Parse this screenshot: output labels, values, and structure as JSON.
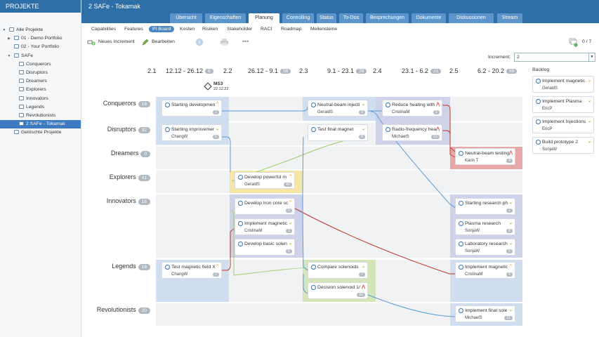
{
  "sidebar": {
    "title": "PROJEKTE",
    "items": [
      {
        "label": "Alle Projekte",
        "indent": 0,
        "arrow": "▼"
      },
      {
        "label": "01 - Demo Portfolio",
        "indent": 1,
        "arrow": "▶"
      },
      {
        "label": "02 - Your Portfolio",
        "indent": 1,
        "arrow": ""
      },
      {
        "label": "SAFe",
        "indent": 1,
        "arrow": "▼"
      },
      {
        "label": "Conquerors",
        "indent": 2,
        "arrow": ""
      },
      {
        "label": "Disruptors",
        "indent": 2,
        "arrow": ""
      },
      {
        "label": "Dreamers",
        "indent": 2,
        "arrow": ""
      },
      {
        "label": "Explorers",
        "indent": 2,
        "arrow": ""
      },
      {
        "label": "Innovators",
        "indent": 2,
        "arrow": ""
      },
      {
        "label": "Legends",
        "indent": 2,
        "arrow": ""
      },
      {
        "label": "Revolutionists",
        "indent": 2,
        "arrow": ""
      },
      {
        "label": "2 SAFe - Tokamak",
        "indent": 2,
        "arrow": "",
        "selected": true
      },
      {
        "label": "Gelöschte Projekte",
        "indent": 1,
        "arrow": ""
      }
    ]
  },
  "header": {
    "title": "2 SAFe - Tokamak"
  },
  "tabs": [
    "Übersicht",
    "Eigenschaften",
    "Planung",
    "Controlling",
    "Status",
    "To-Dos",
    "Besprechungen",
    "Dokumente",
    "Diskussionen",
    "Stream"
  ],
  "active_tab": "Planung",
  "subnav": [
    "Capabilities",
    "Features",
    "PI Board",
    "Kosten",
    "Risiken",
    "Stakeholder",
    "RACI",
    "Roadmap",
    "Meilensteine"
  ],
  "active_subnav": "PI Board",
  "toolbar": {
    "new_increment": "Neues Increment",
    "edit": "Bearbeiten",
    "counter": "0 / 7"
  },
  "increment": {
    "label": "Increment:",
    "value": "2"
  },
  "iterations": [
    {
      "label": "2.1"
    },
    {
      "label": "12.12 - 26.12",
      "badge": "6"
    },
    {
      "label": "2.2"
    },
    {
      "label": "26.12 - 9.1",
      "badge": "58"
    },
    {
      "label": "2.3"
    },
    {
      "label": "9.1 - 23.1",
      "badge": "28"
    },
    {
      "label": "2.4"
    },
    {
      "label": "23.1 - 6.2",
      "badge": "21"
    },
    {
      "label": "2.5"
    },
    {
      "label": "6.2 - 20.2",
      "badge": "55"
    }
  ],
  "milestone": {
    "name": "MS3",
    "date": "22.12.22"
  },
  "teams": [
    {
      "name": "Conquerors",
      "points": "18"
    },
    {
      "name": "Disruptors",
      "points": "32"
    },
    {
      "name": "Dreamers",
      "points": "0"
    },
    {
      "name": "Explorers",
      "points": "41"
    },
    {
      "name": "Innovators",
      "points": "18"
    },
    {
      "name": "Legends",
      "points": "18"
    },
    {
      "name": "Revolutionists",
      "points": "20"
    }
  ],
  "cards": [
    {
      "id": "c1",
      "title": "Starting developmen",
      "user": "",
      "pts": "2",
      "prio": "up",
      "prio_color": "#e8a000"
    },
    {
      "id": "c2",
      "title": "Neutral-beam injecti",
      "user": "GeraldS",
      "pts": "8",
      "prio": "down",
      "prio_color": "#7cb800"
    },
    {
      "id": "c3",
      "title": "Reduce heating with",
      "user": "CristinaM",
      "pts": "5",
      "prio": "top",
      "prio_color": "#d9342b"
    },
    {
      "id": "c4",
      "title": "Starting improvemer",
      "user": "ChangW",
      "pts": "5",
      "prio": "down",
      "prio_color": "#7cb800"
    },
    {
      "id": "c5",
      "title": "Test final magnet",
      "user": "",
      "pts": "8",
      "prio": "down",
      "prio_color": "#7cb800"
    },
    {
      "id": "c6",
      "title": "Radio-frequency hea",
      "user": "MichaelS",
      "pts": "13",
      "prio": "top",
      "prio_color": "#d9342b"
    },
    {
      "id": "c7",
      "title": "Neutral-beam testing",
      "user": "Karin T",
      "pts": "4",
      "prio": "top",
      "prio_color": "#d9342b"
    },
    {
      "id": "c8",
      "title": "Develop powerful m",
      "user": "GeraldS",
      "pts": "40",
      "prio": "up",
      "prio_color": "#e8a000"
    },
    {
      "id": "c9",
      "title": "Develop Iron core sc",
      "user": "",
      "pts": "5",
      "prio": "up",
      "prio_color": "#e8a000"
    },
    {
      "id": "c10",
      "title": "Implement magnetic",
      "user": "CristinaM",
      "pts": "3",
      "prio": "down",
      "prio_color": "#7cb800"
    },
    {
      "id": "c11",
      "title": "Develop basic solen",
      "user": "",
      "pts": "5",
      "prio": "down",
      "prio_color": "#7cb800"
    },
    {
      "id": "c12",
      "title": "Starting research ph",
      "user": "",
      "pts": "2",
      "prio": "down",
      "prio_color": "#7cb800"
    },
    {
      "id": "c13",
      "title": "Plasma research",
      "user": "SonjaW",
      "pts": "8",
      "prio": "down",
      "prio_color": "#7cb800"
    },
    {
      "id": "c14",
      "title": "Laboratory research",
      "user": "SonjaW",
      "pts": "5",
      "prio": "down",
      "prio_color": "#7cb800"
    },
    {
      "id": "c15",
      "title": "Test magnetic field X",
      "user": "ChangW",
      "pts": "2",
      "prio": "up",
      "prio_color": "#e8a000"
    },
    {
      "id": "c16",
      "title": "Compare solenoids",
      "user": "",
      "pts": "7",
      "prio": "down",
      "prio_color": "#7cb800"
    },
    {
      "id": "c17",
      "title": "Decision solenoid 1/",
      "user": "",
      "pts": "10",
      "prio": "top",
      "prio_color": "#d9342b"
    },
    {
      "id": "c18",
      "title": "Implement magnetic",
      "user": "CristinaM",
      "pts": "5",
      "prio": "up",
      "prio_color": "#e8a000"
    },
    {
      "id": "c19",
      "title": "Implement final sole",
      "user": "MichaelS",
      "pts": "11",
      "prio": "down",
      "prio_color": "#7cb800"
    }
  ],
  "backlog": {
    "title": "Backlog",
    "items": [
      {
        "title": "Implement magnetic",
        "user": "GeraldS",
        "prio_color": "#e8a000"
      },
      {
        "title": "Implement Plasma",
        "user": "EricP",
        "prio_color": "#7cb800"
      },
      {
        "title": "Implement Injections",
        "user": "EricP",
        "prio_color": "#7cb800"
      },
      {
        "title": "Build prototype 2",
        "user": "SonjaW",
        "prio_color": "#7cb800"
      }
    ]
  },
  "colors": {
    "brand": "#2f6fa8",
    "dependency_blue": "#5a9bd5",
    "dependency_green": "#9ccf6a",
    "dependency_red": "#c0392b"
  }
}
